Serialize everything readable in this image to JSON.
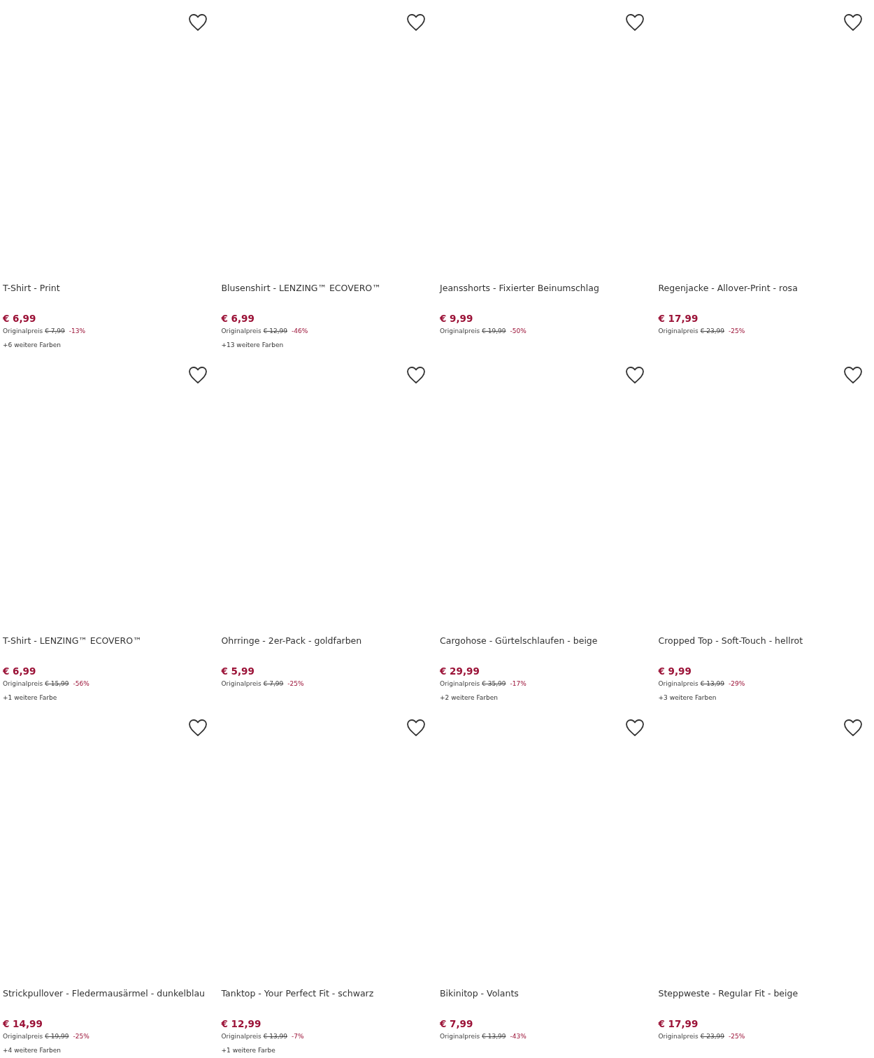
{
  "products": [
    {
      "title": "T-Shirt - Print",
      "price": "€ 6,99",
      "original_label": "Originalpreis",
      "original_price": "€ 7,99",
      "discount": "-13%",
      "more_colors": "+6 weitere Farben"
    },
    {
      "title": "Blusenshirt - LENZING™ ECOVERO™",
      "price": "€ 6,99",
      "original_label": "Originalpreis",
      "original_price": "€ 12,99",
      "discount": "-46%",
      "more_colors": "+13 weitere Farben"
    },
    {
      "title": "Jeansshorts - Fixierter Beinumschlag",
      "price": "€ 9,99",
      "original_label": "Originalpreis",
      "original_price": "€ 19,99",
      "discount": "-50%"
    },
    {
      "title": "Regenjacke - Allover-Print - rosa",
      "price": "€ 17,99",
      "original_label": "Originalpreis",
      "original_price": "€ 23,99",
      "discount": "-25%"
    },
    {
      "title": "T-Shirt - LENZING™ ECOVERO™",
      "price": "€ 6,99",
      "original_label": "Originalpreis",
      "original_price": "€ 15,99",
      "discount": "-56%",
      "more_colors": "+1 weitere Farbe"
    },
    {
      "title": "Ohrringe - 2er-Pack - goldfarben",
      "price": "€ 5,99",
      "original_label": "Originalpreis",
      "original_price": "€ 7,99",
      "discount": "-25%"
    },
    {
      "title": "Cargohose - Gürtelschlaufen - beige",
      "price": "€ 29,99",
      "original_label": "Originalpreis",
      "original_price": "€ 35,99",
      "discount": "-17%",
      "more_colors": "+2 weitere Farben"
    },
    {
      "title": "Cropped Top - Soft-Touch - hellrot",
      "price": "€ 9,99",
      "original_label": "Originalpreis",
      "original_price": "€ 13,99",
      "discount": "-29%",
      "more_colors": "+3 weitere Farben"
    },
    {
      "title": "Strickpullover - Fledermausärmel - dunkelblau",
      "price": "€ 14,99",
      "original_label": "Originalpreis",
      "original_price": "€ 19,99",
      "discount": "-25%",
      "more_colors": "+4 weitere Farben"
    },
    {
      "title": "Tanktop - Your Perfect Fit - schwarz",
      "price": "€ 12,99",
      "original_label": "Originalpreis",
      "original_price": "€ 13,99",
      "discount": "-7%",
      "more_colors": "+1 weitere Farbe"
    },
    {
      "title": "Bikinitop - Volants",
      "price": "€ 7,99",
      "original_label": "Originalpreis",
      "original_price": "€ 13,99",
      "discount": "-43%"
    },
    {
      "title": "Steppweste - Regular Fit - beige",
      "price": "€ 17,99",
      "original_label": "Originalpreis",
      "original_price": "€ 23,99",
      "discount": "-25%"
    }
  ]
}
